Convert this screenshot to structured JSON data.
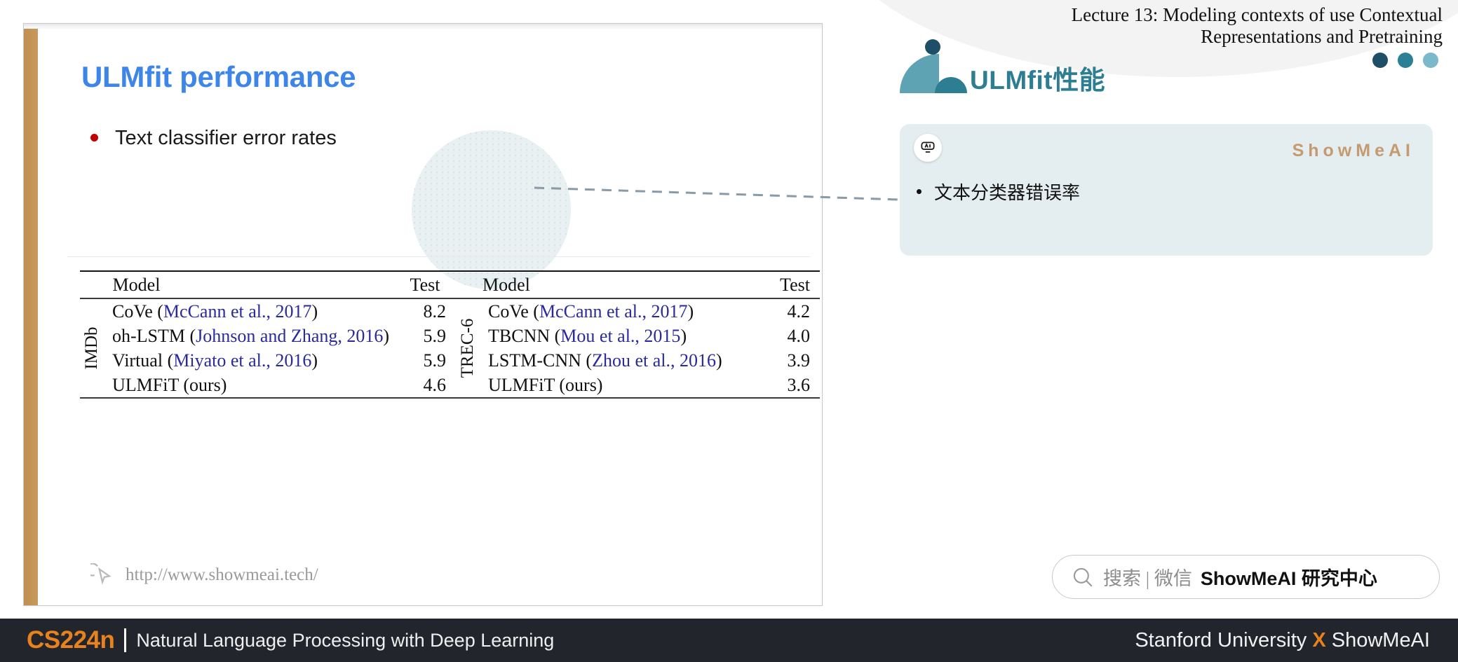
{
  "header": {
    "lecture_title_line1": "Lecture 13:  Modeling contexts of use Contextual",
    "lecture_title_line2": "Representations and Pretraining",
    "cn_title": "ULMfit性能"
  },
  "slide": {
    "title": "ULMfit performance",
    "bullet": "Text classifier error rates",
    "footer_url": "http://www.showmeai.tech/",
    "cursor_icon": "cursor-arrow-icon",
    "title_color": "#3d86e8",
    "bullet_color": "#c00000",
    "accent_bar_color": "#c4924f"
  },
  "table": {
    "headers": [
      "Model",
      "Test",
      "Model",
      "Test"
    ],
    "left_group_label": "IMDb",
    "right_group_label": "TREC-6",
    "rows": [
      {
        "left_model": "CoVe (",
        "left_cite": "McCann et al., 2017",
        "left_model_end": ")",
        "left_test": "8.2",
        "left_bold": false,
        "right_model": "CoVe (",
        "right_cite": "McCann et al., 2017",
        "right_model_end": ")",
        "right_test": "4.2",
        "right_bold": false
      },
      {
        "left_model": "oh-LSTM (",
        "left_cite": "Johnson and Zhang, 2016",
        "left_model_end": ")",
        "left_test": "5.9",
        "left_bold": false,
        "right_model": "TBCNN (",
        "right_cite": "Mou et al., 2015",
        "right_model_end": ")",
        "right_test": "4.0",
        "right_bold": false
      },
      {
        "left_model": "Virtual (",
        "left_cite": "Miyato et al., 2016",
        "left_model_end": ")",
        "left_test": "5.9",
        "left_bold": false,
        "right_model": "LSTM-CNN (",
        "right_cite": "Zhou et al., 2016",
        "right_model_end": ")",
        "right_test": "3.9",
        "right_bold": false
      },
      {
        "left_model": "ULMFiT (ours)",
        "left_cite": "",
        "left_model_end": "",
        "left_test": "4.6",
        "left_bold": true,
        "right_model": "ULMFiT (ours)",
        "right_cite": "",
        "right_model_end": "",
        "right_test": "3.6",
        "right_bold": true
      }
    ]
  },
  "card": {
    "ai_icon": "ai-robot-icon",
    "watermark": "ShowMeAI",
    "bullet": "文本分类器错误率",
    "background": "#e4edef"
  },
  "search": {
    "icon": "magnifier-icon",
    "grey_text": "搜索 | 微信",
    "bold_text": "ShowMeAI 研究中心"
  },
  "bottom_bar": {
    "course_code": "CS224n",
    "course_name": "Natural Language Processing with Deep Learning",
    "right_left": "Stanford University ",
    "right_x": "X",
    "right_right": " ShowMeAI",
    "background": "#23252d",
    "accent": "#e8821e"
  },
  "decor": {
    "dots": [
      "#1e4f66",
      "#2c8096",
      "#79b9c9"
    ],
    "circle_fill": "#e9f0f1",
    "connector": "dashed-connector-line"
  }
}
